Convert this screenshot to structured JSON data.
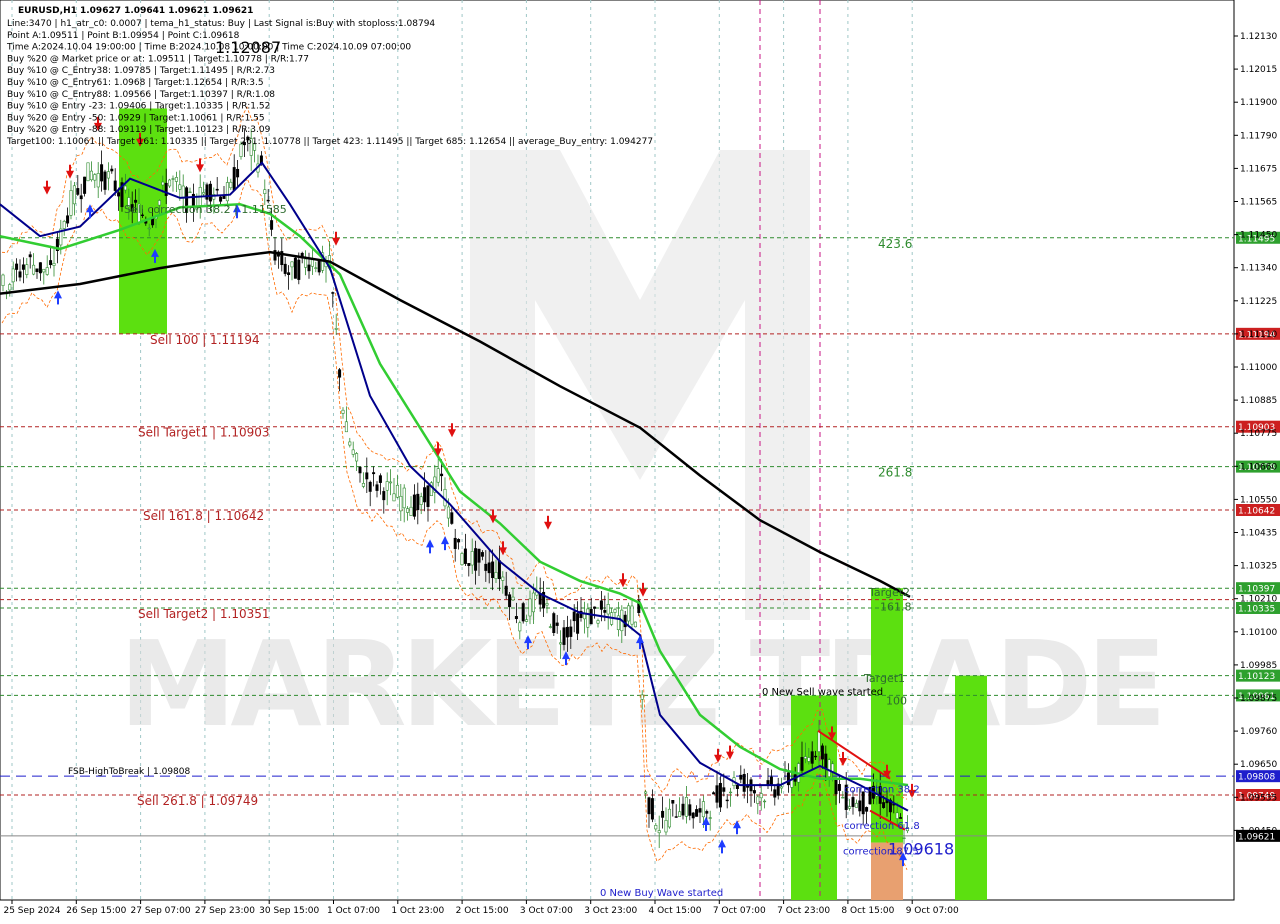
{
  "chart_data": {
    "type": "candlestick",
    "symbol_header": "EURUSD,H1  1.09627 1.09641 1.09621 1.09621",
    "info_lines": [
      "Line:3470  |  h1_atr_c0: 0.0007  |  tema_h1_status: Buy  |  Last Signal is:Buy with stoploss:1.08794",
      "Point A:1.09511  |  Point B:1.09954  |  Point C:1.09618",
      "Time A:2024.10.04 19:00:00  |  Time B:2024.10.08 10:00:00  |  Time C:2024.10.09 07:00:00",
      "Buy %20 @ Market price or at: 1.09511  |  Target:1.10778  |  R/R:1.77",
      "Buy %10 @ C_Entry38: 1.09785  |  Target:1.11495  |  R/R:2.73",
      "Buy %10 @ C_Entry61: 1.0968  |  Target:1.12654  |  R/R:3.5",
      "Buy %10 @ C_Entry88: 1.09566  |  Target:1.10397  |  R/R:1.08",
      "Buy %10 @ Entry -23: 1.09406  |  Target:1.10335  |  R/R:1.52",
      "Buy %20 @ Entry -50: 1.0929  |  Target:1.10061  |  R/R:1.55",
      "Buy %20 @ Entry -88: 1.09119  |  Target:1.10123  |  R/R:3.09",
      "Target100: 1.10061  ||  Target 161: 1.10335  ||  Target 261: 1.10778  ||  Target 423: 1.11495  ||  Target 685: 1.12654  ||  average_Buy_entry: 1.094277"
    ],
    "y_ticks": [
      "1.12130",
      "1.12015",
      "1.11900",
      "1.11790",
      "1.11675",
      "1.11565",
      "1.11450",
      "1.11340",
      "1.11225",
      "1.11110",
      "1.11000",
      "1.10885",
      "1.10775",
      "1.10660",
      "1.10550",
      "1.10435",
      "1.10325",
      "1.10210",
      "1.10100",
      "1.09985",
      "1.09875",
      "1.09760",
      "1.09650",
      "1.09535",
      "1.09450"
    ],
    "x_ticks": [
      "25 Sep 2024",
      "26 Sep 15:00",
      "27 Sep 07:00",
      "27 Sep 23:00",
      "30 Sep 15:00",
      "1 Oct 07:00",
      "1 Oct 23:00",
      "2 Oct 15:00",
      "3 Oct 07:00",
      "3 Oct 23:00",
      "4 Oct 15:00",
      "7 Oct 07:00",
      "7 Oct 23:00",
      "8 Oct 15:00",
      "9 Oct 07:00"
    ],
    "ylim": [
      1.0942,
      1.1224
    ],
    "levels": [
      {
        "label": "423.6",
        "price": 1.11495,
        "badge": "1.11495",
        "color": "#2e8b2e",
        "label_color": "#2e8b2e",
        "style": "dash"
      },
      {
        "label": "Sell 100 | 1.11194",
        "price": 1.11194,
        "badge": "1.11194",
        "color": "#b22222",
        "label_color": "#b22222",
        "style": "dash"
      },
      {
        "label": "Sell Target1 | 1.10903",
        "price": 1.10903,
        "badge": "1.10903",
        "color": "#b22222",
        "label_color": "#b22222",
        "style": "dash"
      },
      {
        "label": "261.8",
        "price": 1.10778,
        "badge": "1.10778",
        "color": "#2e8b2e",
        "label_color": "#2e8b2e",
        "style": "dash"
      },
      {
        "label": "Sell 161.8 | 1.10642",
        "price": 1.10642,
        "badge": "1.10642",
        "color": "#b22222",
        "label_color": "#b22222",
        "style": "dash"
      },
      {
        "label": "",
        "price": 1.10397,
        "badge": "1.10397",
        "color": "#2e8b2e",
        "label_color": "#2e8b2e",
        "style": "dash"
      },
      {
        "label": "",
        "price": 1.10361,
        "badge": "",
        "color": "#b22222",
        "label_color": "#b22222",
        "style": "dash"
      },
      {
        "label": "Sell Target2 | 1.10351",
        "price": 1.10335,
        "badge": "1.10335",
        "color": "#2e8b2e",
        "label_color": "#b22222",
        "style": "dash"
      },
      {
        "label": "",
        "price": 1.10123,
        "badge": "1.10123",
        "color": "#2e8b2e",
        "label_color": "#2e8b2e",
        "style": "dash"
      },
      {
        "label": "",
        "price": 1.10061,
        "badge": "1.10061",
        "color": "#2e8b2e",
        "label_color": "#2e8b2e",
        "style": "dash"
      },
      {
        "label": "FSB-HighToBreak | 1.09808",
        "price": 1.09808,
        "badge": "1.09808",
        "color": "#1e1ecc",
        "label_color": "#000000",
        "style": "longdash"
      },
      {
        "label": "Sell 261.8 | 1.09749",
        "price": 1.09749,
        "badge": "1.09749",
        "color": "#b22222",
        "label_color": "#b22222",
        "style": "dash"
      },
      {
        "label": "",
        "price": 1.09621,
        "badge": "1.09621",
        "color": "#888888",
        "label_color": "#000000",
        "style": "solid"
      }
    ],
    "annotations": [
      {
        "text": "1.12087",
        "price": 1.12087,
        "color": "#000000"
      },
      {
        "text": "Sell correction 38.2 | 1.11585",
        "price": 1.11585,
        "color": "#2e6b2e"
      },
      {
        "text": "Target2",
        "price": 1.10385,
        "color": "#2e6b2e"
      },
      {
        "text": "161.8",
        "price": 1.1034,
        "color": "#2e6b2e"
      },
      {
        "text": "0 New Sell wave started",
        "price": 1.10075,
        "color": "#000000"
      },
      {
        "text": "Target1",
        "price": 1.10115,
        "color": "#2e6b2e"
      },
      {
        "text": "100",
        "price": 1.10045,
        "color": "#2e6b2e"
      },
      {
        "text": "correction 38.2",
        "price": 1.0977,
        "color": "#1e1ecc"
      },
      {
        "text": "correction 61.8",
        "price": 1.09655,
        "color": "#1e1ecc"
      },
      {
        "text": "correction 87.5",
        "price": 1.09575,
        "color": "#1e1ecc"
      },
      {
        "text": "1.09618",
        "price": 1.09575,
        "color": "#1e1ecc"
      },
      {
        "text": "0 New Buy Wave started",
        "price": 1.09445,
        "color": "#1e1ecc"
      }
    ],
    "watermark": "MARKETZ TRADE",
    "colors": {
      "bull": "#2e8b2e",
      "bear": "#000000",
      "ema_fast": "#00008b",
      "ema_mid": "#32cd32",
      "ema_slow": "#000000",
      "zone_green": "#5ce010",
      "zone_orange": "#e8a070",
      "magenta": "#c71585",
      "dash_orange": "#ff6a00"
    }
  }
}
